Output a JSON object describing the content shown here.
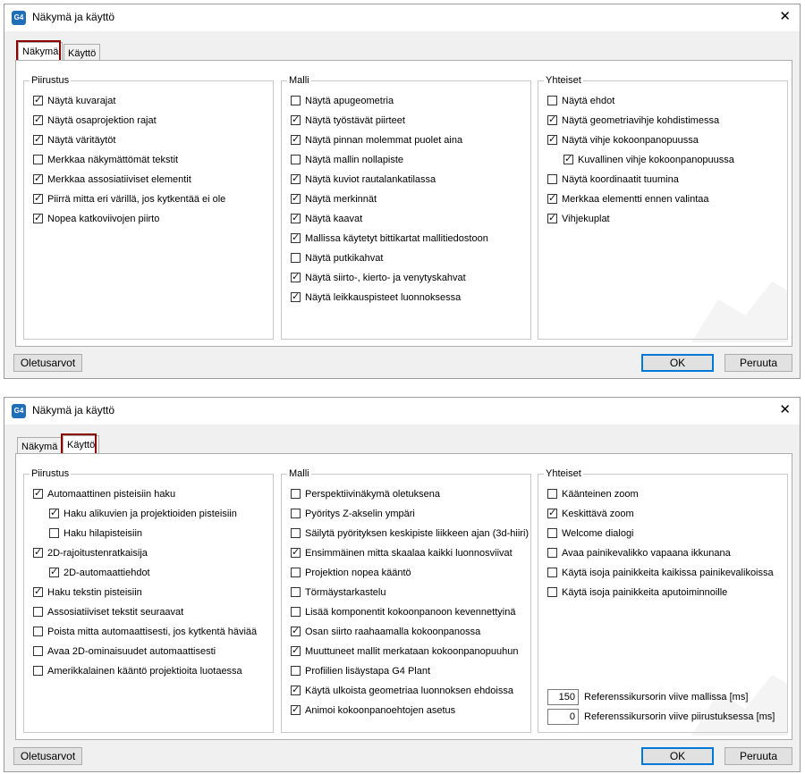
{
  "dialog1": {
    "title": "Näkymä ja käyttö",
    "tabs": [
      "Näkymä",
      "Käyttö"
    ],
    "groups": {
      "piirustus": {
        "title": "Piirustus",
        "items": [
          {
            "label": "Näytä kuvarajat",
            "checked": true
          },
          {
            "label": "Näytä osaprojektion rajat",
            "checked": true
          },
          {
            "label": "Näytä väritäytöt",
            "checked": true
          },
          {
            "label": "Merkkaa näkymättömät tekstit",
            "checked": false
          },
          {
            "label": "Merkkaa assosiatiiviset elementit",
            "checked": true
          },
          {
            "label": "Piirrä mitta eri värillä, jos kytkentää ei ole",
            "checked": true
          },
          {
            "label": "Nopea katkoviivojen piirto",
            "checked": true
          }
        ]
      },
      "malli": {
        "title": "Malli",
        "items": [
          {
            "label": "Näytä apugeometria",
            "checked": false
          },
          {
            "label": "Näytä työstävät piirteet",
            "checked": true
          },
          {
            "label": "Näytä pinnan molemmat puolet aina",
            "checked": true
          },
          {
            "label": "Näytä mallin nollapiste",
            "checked": false
          },
          {
            "label": "Näytä kuviot rautalankatilassa",
            "checked": true
          },
          {
            "label": "Näytä merkinnät",
            "checked": true
          },
          {
            "label": "Näytä kaavat",
            "checked": true
          },
          {
            "label": "Mallissa käytetyt bittikartat mallitiedostoon",
            "checked": true
          },
          {
            "label": "Näytä putkikahvat",
            "checked": false
          },
          {
            "label": "Näytä siirto-, kierto- ja venytyskahvat",
            "checked": true
          },
          {
            "label": "Näytä leikkauspisteet luonnoksessa",
            "checked": true
          }
        ]
      },
      "yhteiset": {
        "title": "Yhteiset",
        "items": [
          {
            "label": "Näytä ehdot",
            "checked": false
          },
          {
            "label": "Näytä geometriavihje kohdistimessa",
            "checked": true
          },
          {
            "label": "Näytä vihje kokoonpanopuussa",
            "checked": true
          },
          {
            "label": "Kuvallinen vihje kokoonpanopuussa",
            "checked": true
          },
          {
            "label": "Näytä koordinaatit tuumina",
            "checked": false
          },
          {
            "label": "Merkkaa elementti ennen valintaa",
            "checked": true
          },
          {
            "label": "Vihjekuplat",
            "checked": true
          }
        ]
      }
    },
    "buttons": {
      "defaults": "Oletusarvot",
      "ok": "OK",
      "cancel": "Peruuta"
    }
  },
  "dialog2": {
    "title": "Näkymä ja käyttö",
    "tabs": [
      "Näkymä",
      "Käyttö"
    ],
    "groups": {
      "piirustus": {
        "title": "Piirustus",
        "items": [
          {
            "label": "Automaattinen pisteisiin haku",
            "checked": true
          },
          {
            "label": "Haku alikuvien ja projektioiden pisteisiin",
            "checked": true
          },
          {
            "label": "Haku hilapisteisiin",
            "checked": false
          },
          {
            "label": "2D-rajoitustenratkaisija",
            "checked": true
          },
          {
            "label": "2D-automaattiehdot",
            "checked": true
          },
          {
            "label": "Haku tekstin pisteisiin",
            "checked": true
          },
          {
            "label": "Assosiatiiviset tekstit seuraavat",
            "checked": false
          },
          {
            "label": "Poista mitta automaattisesti, jos kytkentä häviää",
            "checked": false
          },
          {
            "label": "Avaa 2D-ominaisuudet automaattisesti",
            "checked": false
          },
          {
            "label": "Amerikkalainen kääntö projektioita luotaessa",
            "checked": false
          }
        ]
      },
      "malli": {
        "title": "Malli",
        "items": [
          {
            "label": "Perspektiivinäkymä oletuksena",
            "checked": false
          },
          {
            "label": "Pyöritys Z-akselin ympäri",
            "checked": false
          },
          {
            "label": "Säilytä pyörityksen keskipiste liikkeen ajan (3d-hiiri)",
            "checked": false
          },
          {
            "label": "Ensimmäinen mitta skaalaa kaikki luonnosviivat",
            "checked": true
          },
          {
            "label": "Projektion nopea kääntö",
            "checked": false
          },
          {
            "label": "Törmäystarkastelu",
            "checked": false
          },
          {
            "label": "Lisää komponentit kokoonpanoon kevennettyinä",
            "checked": false
          },
          {
            "label": "Osan siirto raahaamalla kokoonpanossa",
            "checked": true
          },
          {
            "label": "Muuttuneet mallit merkataan kokoonpanopuuhun",
            "checked": true
          },
          {
            "label": "Profiilien lisäystapa G4 Plant",
            "checked": false
          },
          {
            "label": "Käytä ulkoista geometriaa luonnoksen ehdoissa",
            "checked": true
          },
          {
            "label": "Animoi kokoonpanoehtojen asetus",
            "checked": true
          }
        ]
      },
      "yhteiset": {
        "title": "Yhteiset",
        "items": [
          {
            "label": "Käänteinen zoom",
            "checked": false
          },
          {
            "label": "Keskittävä zoom",
            "checked": true
          },
          {
            "label": "Welcome dialogi",
            "checked": false
          },
          {
            "label": "Avaa painikevalikko vapaana ikkunana",
            "checked": false
          },
          {
            "label": "Käytä isoja painikkeita kaikissa painikevalikoissa",
            "checked": false
          },
          {
            "label": "Käytä isoja painikkeita aputoiminnoille",
            "checked": false
          }
        ],
        "numeric": [
          {
            "value": "150",
            "label": "Referenssikursorin viive mallissa [ms]"
          },
          {
            "value": "0",
            "label": "Referenssikursorin viive piirustuksessa [ms]"
          }
        ]
      }
    },
    "buttons": {
      "defaults": "Oletusarvot",
      "ok": "OK",
      "cancel": "Peruuta"
    }
  }
}
